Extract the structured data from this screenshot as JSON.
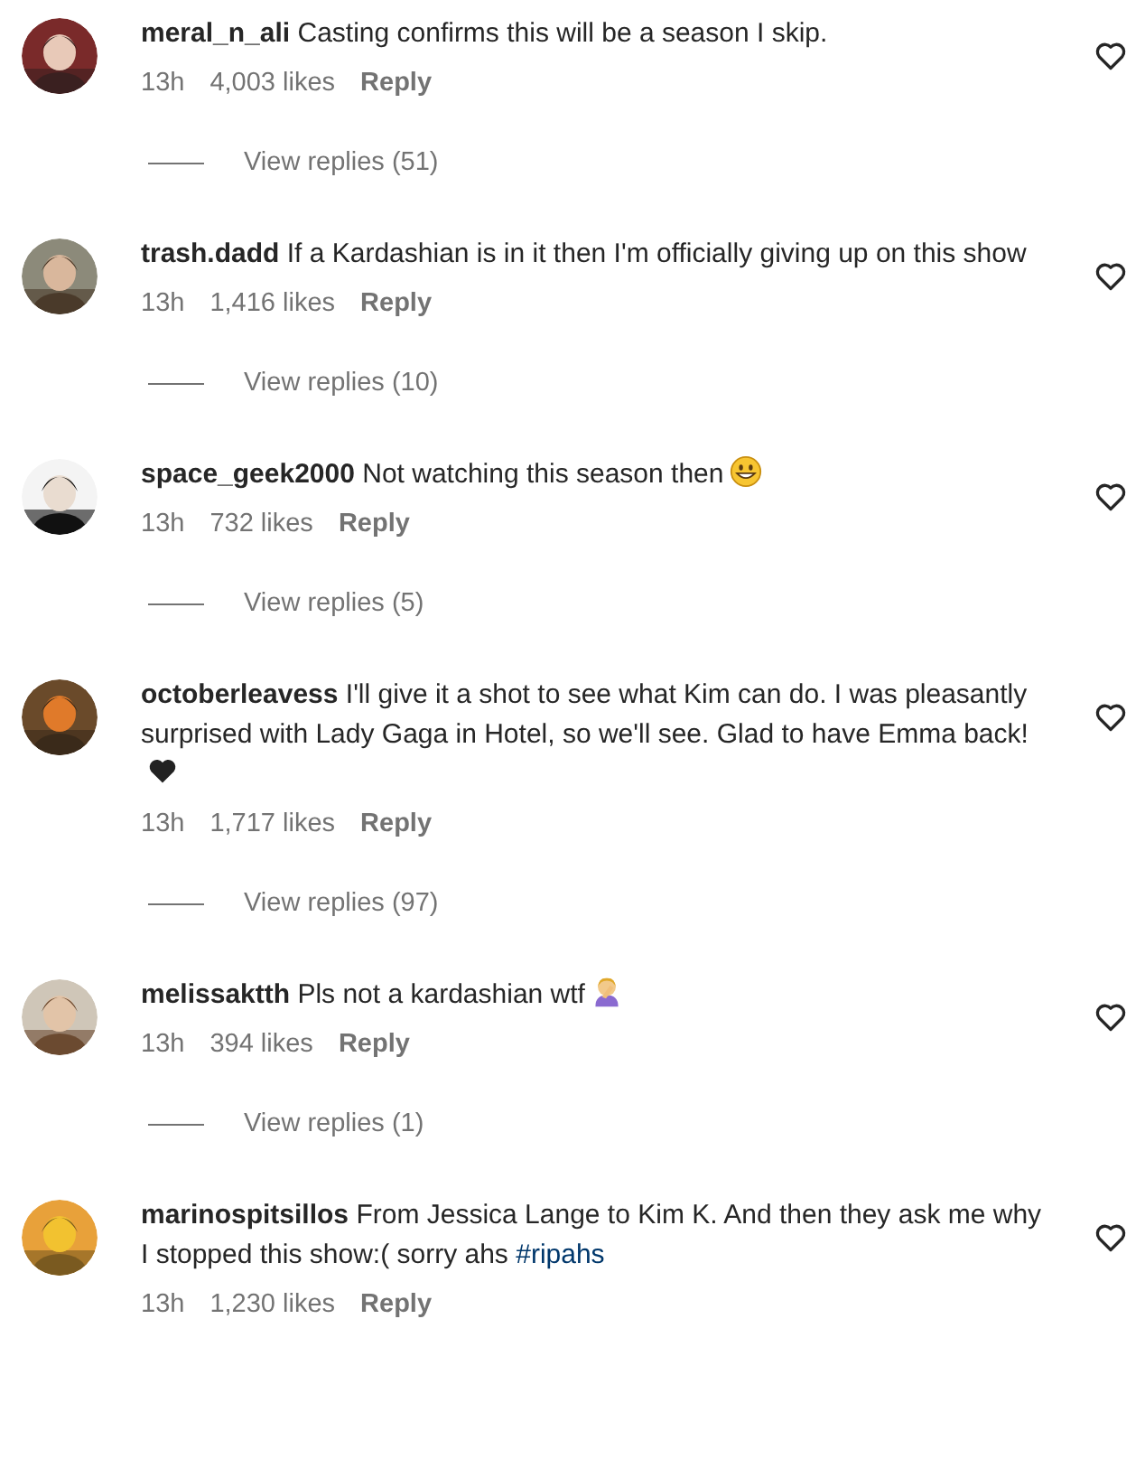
{
  "comments": [
    {
      "text": "**meral_n_ali** Casting confirms this will be a season I skip.",
      "time": "13h",
      "likes": "4,003 likes",
      "reply": "Reply",
      "view_replies": "View replies (51)",
      "liked": false
    },
    {
      "text": "**trash.dadd** If a Kardashian is in it then I'm officially giving up on this show",
      "time": "13h",
      "likes": "1,416 likes",
      "reply": "Reply",
      "view_replies": "View replies (10)",
      "liked": false
    },
    {
      "text": "**space_geek2000** Not watching this season then",
      "emoji": {
        "kind": "grin"
      },
      "time": "13h",
      "likes": "732 likes",
      "reply": "Reply",
      "view_replies": "View replies (5)",
      "liked": false
    },
    {
      "text": "**octoberleavess** I'll give it a shot to see what Kim can do. I was pleasantly surprised with Lady Gaga in Hotel, so we'll see. Glad to have Emma back!",
      "emoji": {
        "kind": "heart"
      },
      "time": "13h",
      "likes": "1,717 likes",
      "reply": "Reply",
      "view_replies": "View replies (97)",
      "liked": false
    },
    {
      "text": "**melissaktth** Pls not a kardashian wtf",
      "emoji": {
        "kind": "facepalm"
      },
      "time": "13h",
      "likes": "394 likes",
      "reply": "Reply",
      "view_replies": "View replies (1)",
      "liked": false
    },
    {
      "text": "**marinospitsillos** From Jessica Lange to Kim K. And then they ask me why I stopped this show:( sorry ahs",
      "hashtag": "#ripahs",
      "time": "13h",
      "likes": "1,230 likes",
      "reply": "Reply",
      "liked": false
    }
  ]
}
